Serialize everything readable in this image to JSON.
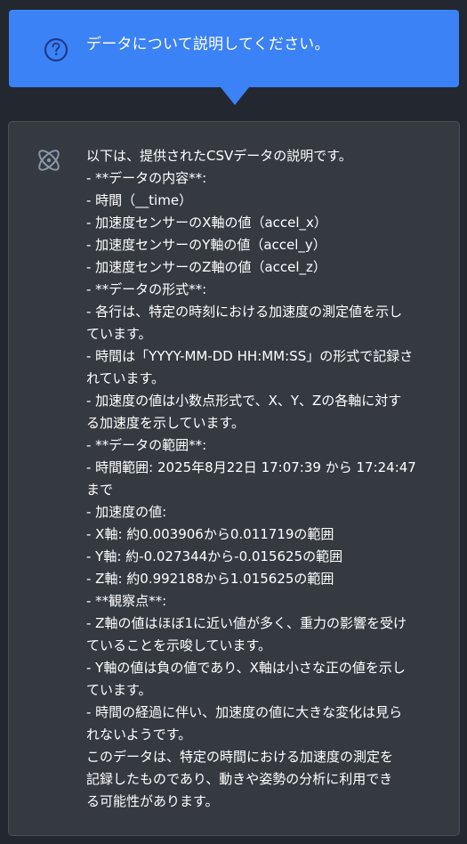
{
  "user_message": {
    "text": "データについて説明してください。",
    "icon": "question-icon"
  },
  "assistant_message": {
    "icon": "atom-icon",
    "lines": [
      "以下は、提供されたCSVデータの説明です。",
      "- **データの内容**:",
      "- 時間（__time）",
      "- 加速度センサーのX軸の値（accel_x）",
      "- 加速度センサーのY軸の値（accel_y）",
      "- 加速度センサーのZ軸の値（accel_z）",
      "- **データの形式**:",
      "- 各行は、特定の時刻における加速度の測定値を示し",
      "ています。",
      "- 時間は「YYYY-MM-DD HH:MM:SS」の形式で記録さ",
      "れています。",
      "- 加速度の値は小数点形式で、X、Y、Zの各軸に対す",
      "る加速度を示しています。",
      "- **データの範囲**:",
      "- 時間範囲: 2025年8月22日 17:07:39 から 17:24:47",
      "まで",
      "- 加速度の値:",
      "- X軸: 約0.003906から0.011719の範囲",
      "- Y軸: 約-0.027344から-0.015625の範囲",
      "- Z軸: 約0.992188から1.015625の範囲",
      "- **観察点**:",
      "- Z軸の値はほぼ1に近い値が多く、重力の影響を受け",
      "ていることを示唆しています。",
      "- Y軸の値は負の値であり、X軸は小さな正の値を示し",
      "ています。",
      "- 時間の経過に伴い、加速度の値に大きな変化は見ら",
      "れないようです。",
      "このデータは、特定の時間における加速度の測定を",
      "記録したものであり、動きや姿勢の分析に利用でき",
      "る可能性があります。"
    ]
  },
  "colors": {
    "background": "#232830",
    "user_bubble": "#3b82f6",
    "assistant_bubble": "#353a41",
    "user_icon": "#1e3a8a",
    "assistant_icon": "#8a96a8"
  }
}
